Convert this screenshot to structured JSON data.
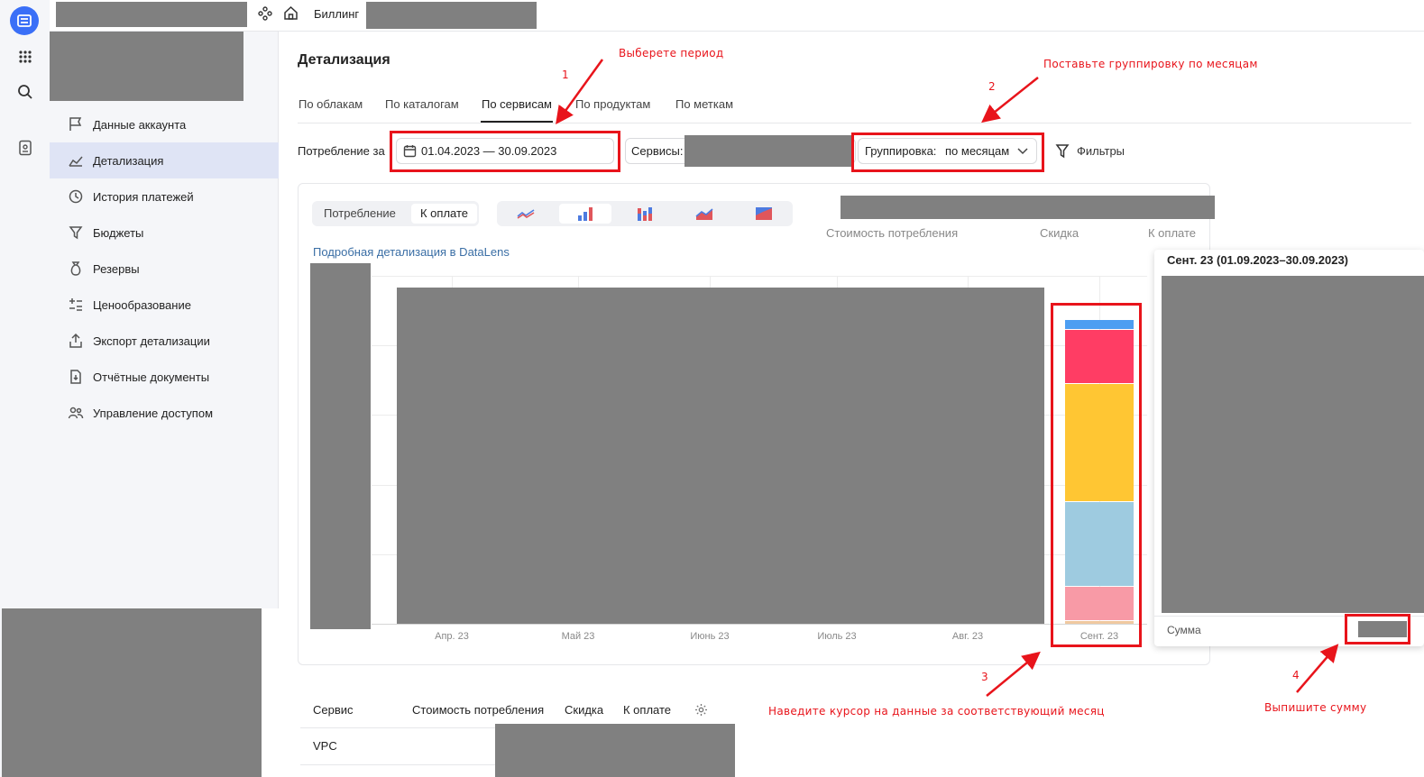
{
  "topbar": {
    "breadcrumb": "Биллинг"
  },
  "sidebar": {
    "items": [
      {
        "label": "Данные аккаунта",
        "icon": "flag-icon"
      },
      {
        "label": "Детализация",
        "icon": "chart-area-icon",
        "active": true
      },
      {
        "label": "История платежей",
        "icon": "history-icon"
      },
      {
        "label": "Бюджеты",
        "icon": "funnel-icon"
      },
      {
        "label": "Резервы",
        "icon": "money-bag-icon"
      },
      {
        "label": "Ценообразование",
        "icon": "calculator-icon"
      },
      {
        "label": "Экспорт детализации",
        "icon": "export-icon"
      },
      {
        "label": "Отчётные документы",
        "icon": "document-icon"
      },
      {
        "label": "Управление доступом",
        "icon": "users-icon"
      }
    ]
  },
  "page": {
    "title": "Детализация"
  },
  "tabs": [
    "По облакам",
    "По каталогам",
    "По сервисам",
    "По продуктам",
    "По меткам"
  ],
  "filters": {
    "period_label": "Потребление за",
    "period_value": "01.04.2023 — 30.09.2023",
    "services_label": "Сервисы:",
    "grouping_label": "Группировка:",
    "grouping_value": "по месяцам",
    "filters_button": "Фильтры"
  },
  "chart_controls": {
    "mode_options": [
      "Потребление",
      "К оплате"
    ],
    "mode_selected": "К оплате",
    "datalens_link": "Подробная детализация в DataLens"
  },
  "summary_headers": [
    "Стоимость потребления",
    "Скидка",
    "К оплате"
  ],
  "colors": {
    "accent": "#3a6ff7",
    "annotation": "#e8141b",
    "link": "#3a6ea5",
    "redaction": "#808080"
  },
  "chart_data": {
    "type": "bar",
    "stacked": true,
    "categories": [
      "Апр. 23",
      "Май 23",
      "Июнь 23",
      "Июль 23",
      "Авг. 23",
      "Сент. 23"
    ],
    "sept_segment_colors": [
      "#f0c9a0",
      "#f89aa6",
      "#9ecbe0",
      "#ffc633",
      "#ff3d64",
      "#4d9ef2"
    ],
    "sept_segment_shares": [
      0.01,
      0.1,
      0.25,
      0.35,
      0.16,
      0.03
    ]
  },
  "tooltip": {
    "title": "Сент. 23 (01.09.2023–30.09.2023)",
    "sum_label": "Сумма"
  },
  "table": {
    "headers": [
      "Сервис",
      "Стоимость потребления",
      "Скидка",
      "К оплате"
    ],
    "rows": [
      {
        "service": "VPC"
      }
    ]
  },
  "annotations": {
    "a1_text": "Выберете период",
    "a1_num": "1",
    "a2_text": "Поставьте группировку по месяцам",
    "a2_num": "2",
    "a3_text": "Наведите курсор на данные за соответствующий месяц",
    "a3_num": "3",
    "a4_text": "Выпишите сумму",
    "a4_num": "4"
  }
}
